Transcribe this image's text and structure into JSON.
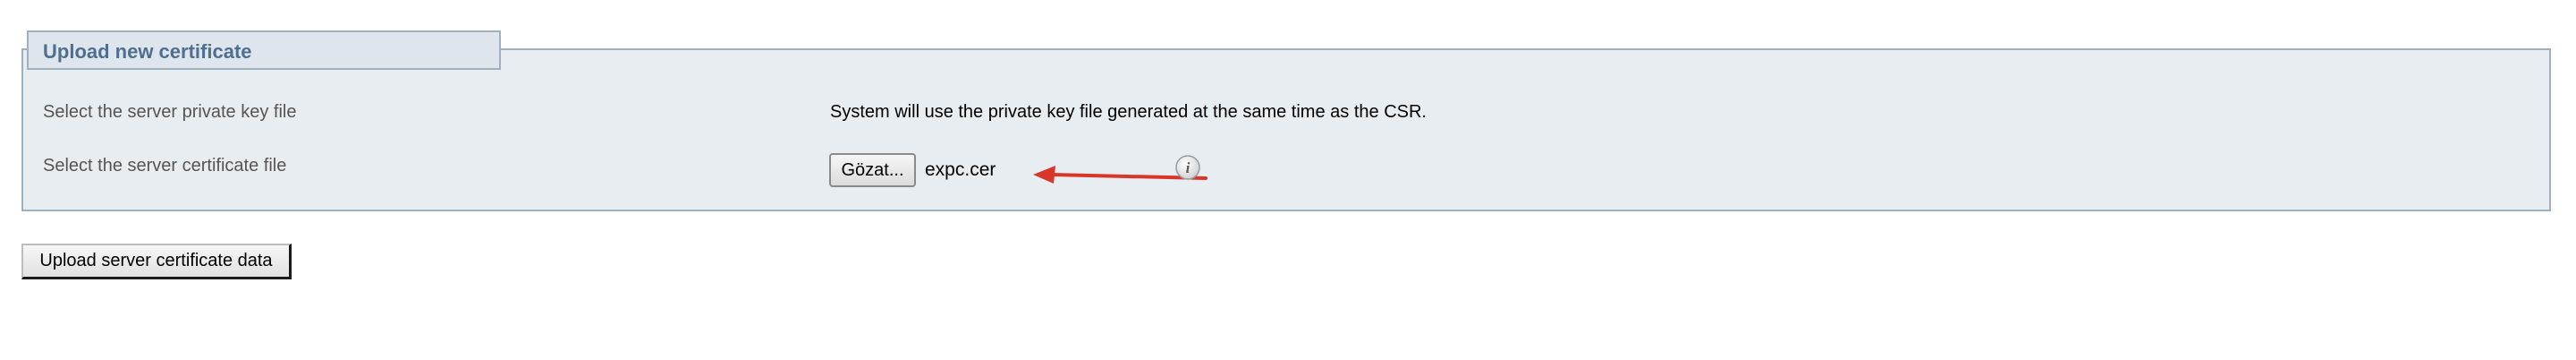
{
  "panel": {
    "title": "Upload new certificate",
    "rows": [
      {
        "label": "Select the server private key file",
        "value": "System will use the private key file generated at the same time as the CSR."
      },
      {
        "label": "Select the server certificate file",
        "browse_label": "Gözat...",
        "file_name": "expc.cer"
      }
    ]
  },
  "icons": {
    "info": "info-icon",
    "annotation": "red-arrow-annotation"
  },
  "colors": {
    "panel_background": "#e7edf1",
    "panel_border": "#9fb0bf",
    "title_text": "#4e6f8f",
    "annotation_arrow": "#d9362b"
  },
  "actions": {
    "upload_label": "Upload server certificate data"
  }
}
